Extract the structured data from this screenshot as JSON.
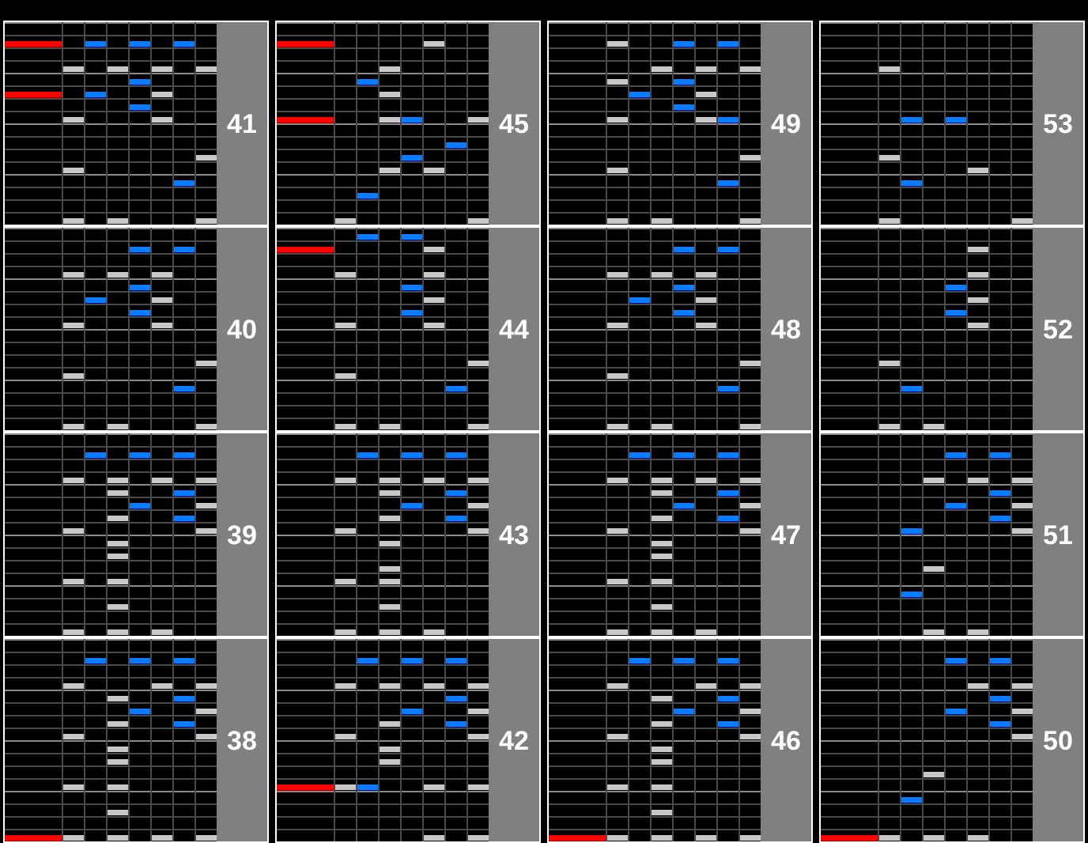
{
  "columns": [
    {
      "measures": [
        {
          "number": "41"
        },
        {
          "number": "40"
        },
        {
          "number": "39"
        },
        {
          "number": "38"
        }
      ]
    },
    {
      "measures": [
        {
          "number": "45"
        },
        {
          "number": "44"
        },
        {
          "number": "43"
        },
        {
          "number": "42"
        }
      ]
    },
    {
      "measures": [
        {
          "number": "49"
        },
        {
          "number": "48"
        },
        {
          "number": "47"
        },
        {
          "number": "46"
        }
      ]
    },
    {
      "measures": [
        {
          "number": "53"
        },
        {
          "number": "52"
        },
        {
          "number": "51"
        },
        {
          "number": "50"
        }
      ]
    }
  ]
}
